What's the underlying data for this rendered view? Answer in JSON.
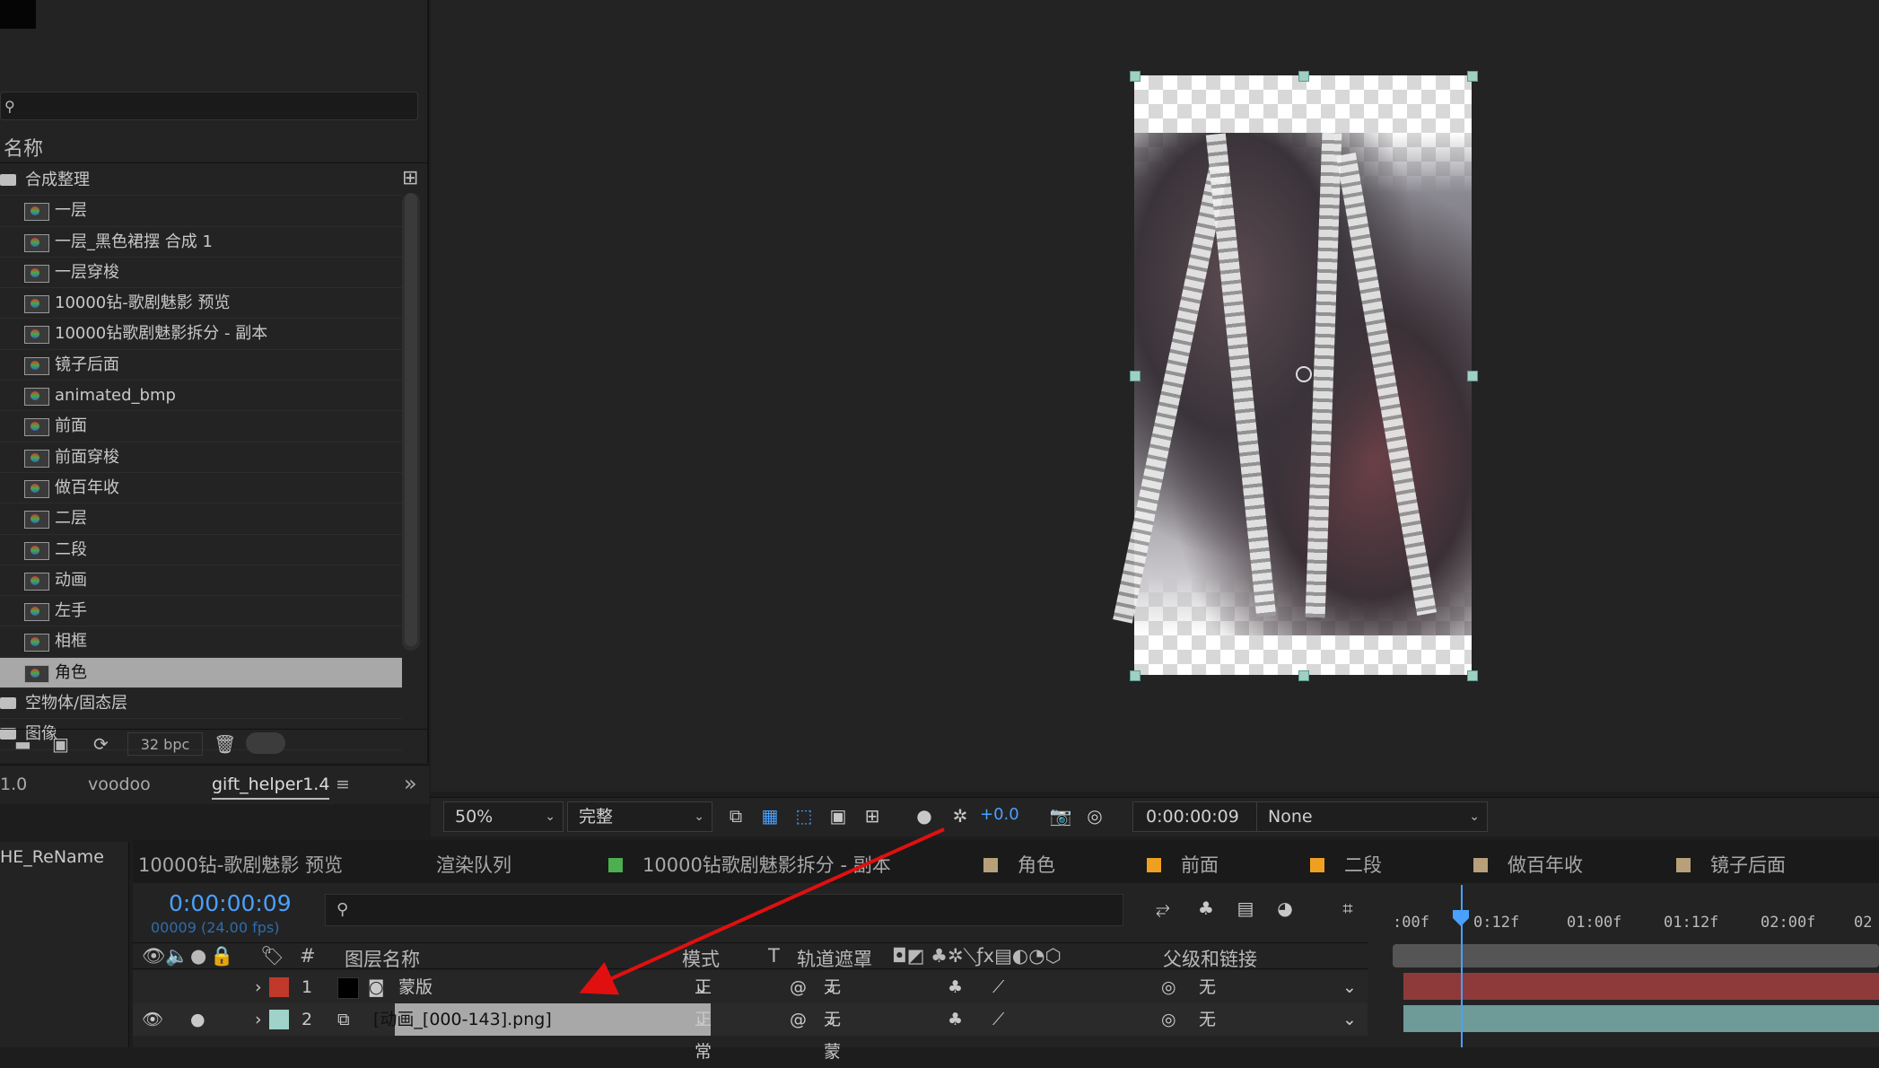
{
  "project": {
    "search_placeholder": "",
    "column_name": "名称",
    "items": [
      {
        "label": "合成整理",
        "type": "folder"
      },
      {
        "label": "一层",
        "type": "comp"
      },
      {
        "label": "一层_黑色裙摆 合成 1",
        "type": "comp"
      },
      {
        "label": "一层穿梭",
        "type": "comp"
      },
      {
        "label": "10000钻-歌剧魅影 预览",
        "type": "comp"
      },
      {
        "label": "10000钻歌剧魅影拆分 - 副本",
        "type": "comp"
      },
      {
        "label": "镜子后面",
        "type": "comp"
      },
      {
        "label": "animated_bmp",
        "type": "comp"
      },
      {
        "label": "前面",
        "type": "comp"
      },
      {
        "label": "前面穿梭",
        "type": "comp"
      },
      {
        "label": "做百年收",
        "type": "comp"
      },
      {
        "label": "二层",
        "type": "comp"
      },
      {
        "label": "二段",
        "type": "comp"
      },
      {
        "label": "动画",
        "type": "comp"
      },
      {
        "label": "左手",
        "type": "comp"
      },
      {
        "label": "相框",
        "type": "comp"
      },
      {
        "label": "角色",
        "type": "comp",
        "selected": true
      },
      {
        "label": "空物体/固态层",
        "type": "folder"
      },
      {
        "label": "图像",
        "type": "folder"
      }
    ],
    "bpc": "32 bpc"
  },
  "lower_tabs": {
    "t1": "1.0",
    "t2": "voodoo",
    "t3": "gift_helper1.4",
    "menu": "≡",
    "more": "»"
  },
  "rename_panel": {
    "title": "HE_ReName"
  },
  "viewer_toolbar": {
    "zoom": "50%",
    "quality": "完整",
    "exposure": "+0.0",
    "timecode": "0:00:00:09",
    "view": "None"
  },
  "timeline_tabs": [
    {
      "label": "10000钻-歌剧魅影 预览",
      "color": ""
    },
    {
      "label": "渲染队列",
      "color": ""
    },
    {
      "label": "10000钻歌剧魅影拆分 - 副本",
      "color": "#4caf50"
    },
    {
      "label": "角色",
      "color": "#b8a07a"
    },
    {
      "label": "前面",
      "color": "#f0a020"
    },
    {
      "label": "二段",
      "color": "#f0a020"
    },
    {
      "label": "做百年收",
      "color": "#b8a07a"
    },
    {
      "label": "镜子后面",
      "color": "#b8a07a"
    }
  ],
  "timeline": {
    "timecode": "0:00:00:09",
    "frames": "00009 (24.00 fps)",
    "columns": {
      "hash": "#",
      "layer_name": "图层名称",
      "mode": "模式",
      "t": "T",
      "track_matte": "轨道遮罩",
      "parent": "父级和链接"
    },
    "layers": [
      {
        "num": "1",
        "name": "蒙版",
        "mode": "正常",
        "matte": "无蒙",
        "parent": "无",
        "color": "#c0392b"
      },
      {
        "num": "2",
        "name": "[动画_[000-143].png]",
        "mode": "正常",
        "matte": "无蒙",
        "parent": "无",
        "color": "#9fd3c9"
      }
    ],
    "ruler": [
      ":00f",
      "0:12f",
      "01:00f",
      "01:12f",
      "02:00f",
      "02"
    ]
  }
}
